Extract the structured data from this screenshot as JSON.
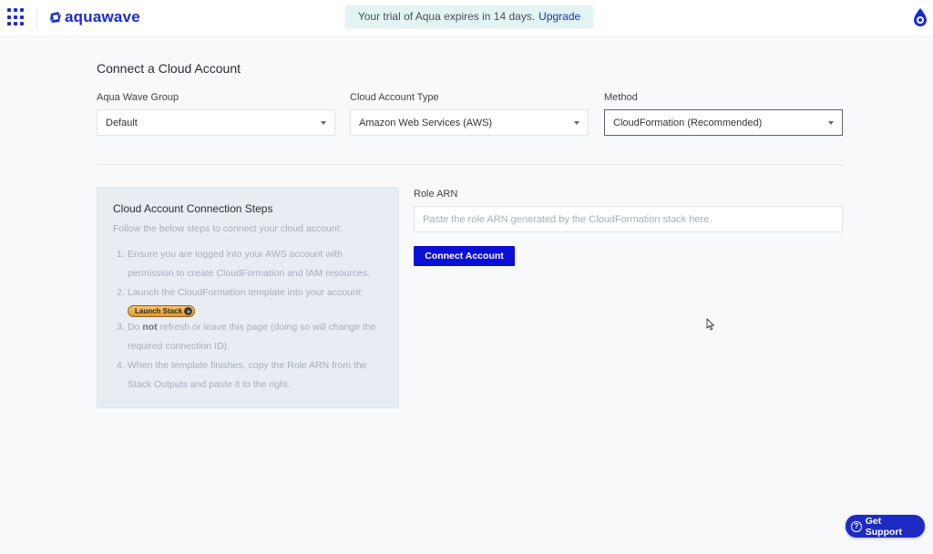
{
  "brand": {
    "name": "aquawave",
    "accent": "#1b2bd1"
  },
  "trial_banner": {
    "text": "Your trial of Aqua expires in 14 days.",
    "link": "Upgrade"
  },
  "page": {
    "title": "Connect a Cloud Account"
  },
  "fields": [
    {
      "label": "Aqua Wave Group",
      "value": "Default"
    },
    {
      "label": "Cloud Account Type",
      "value": "Amazon Web Services (AWS)"
    },
    {
      "label": "Method",
      "value": "CloudFormation (Recommended)"
    }
  ],
  "steps": {
    "title": "Cloud Account Connection Steps",
    "intro": "Follow the below steps to connect your cloud account:",
    "items": [
      {
        "num": "1.",
        "text": "Ensure you are logged into your AWS account with permission to create CloudFormation and IAM resources."
      },
      {
        "num": "2.",
        "text": "Launch the CloudFormation template into your account:"
      },
      {
        "num": "3.",
        "pre": "Do ",
        "bold": "not",
        "post": " refresh or leave this page (doing so will change the required connection ID)."
      },
      {
        "num": "4.",
        "text": "When the template finishes, copy the Role ARN from the Stack Outputs and paste it to the right."
      }
    ],
    "launch_button": "Launch Stack"
  },
  "role_arn": {
    "label": "Role ARN",
    "value": "",
    "placeholder": "Paste the role ARN generated by the CloudFormation stack here."
  },
  "connect_button": "Connect Account",
  "support_button": "Get Support"
}
